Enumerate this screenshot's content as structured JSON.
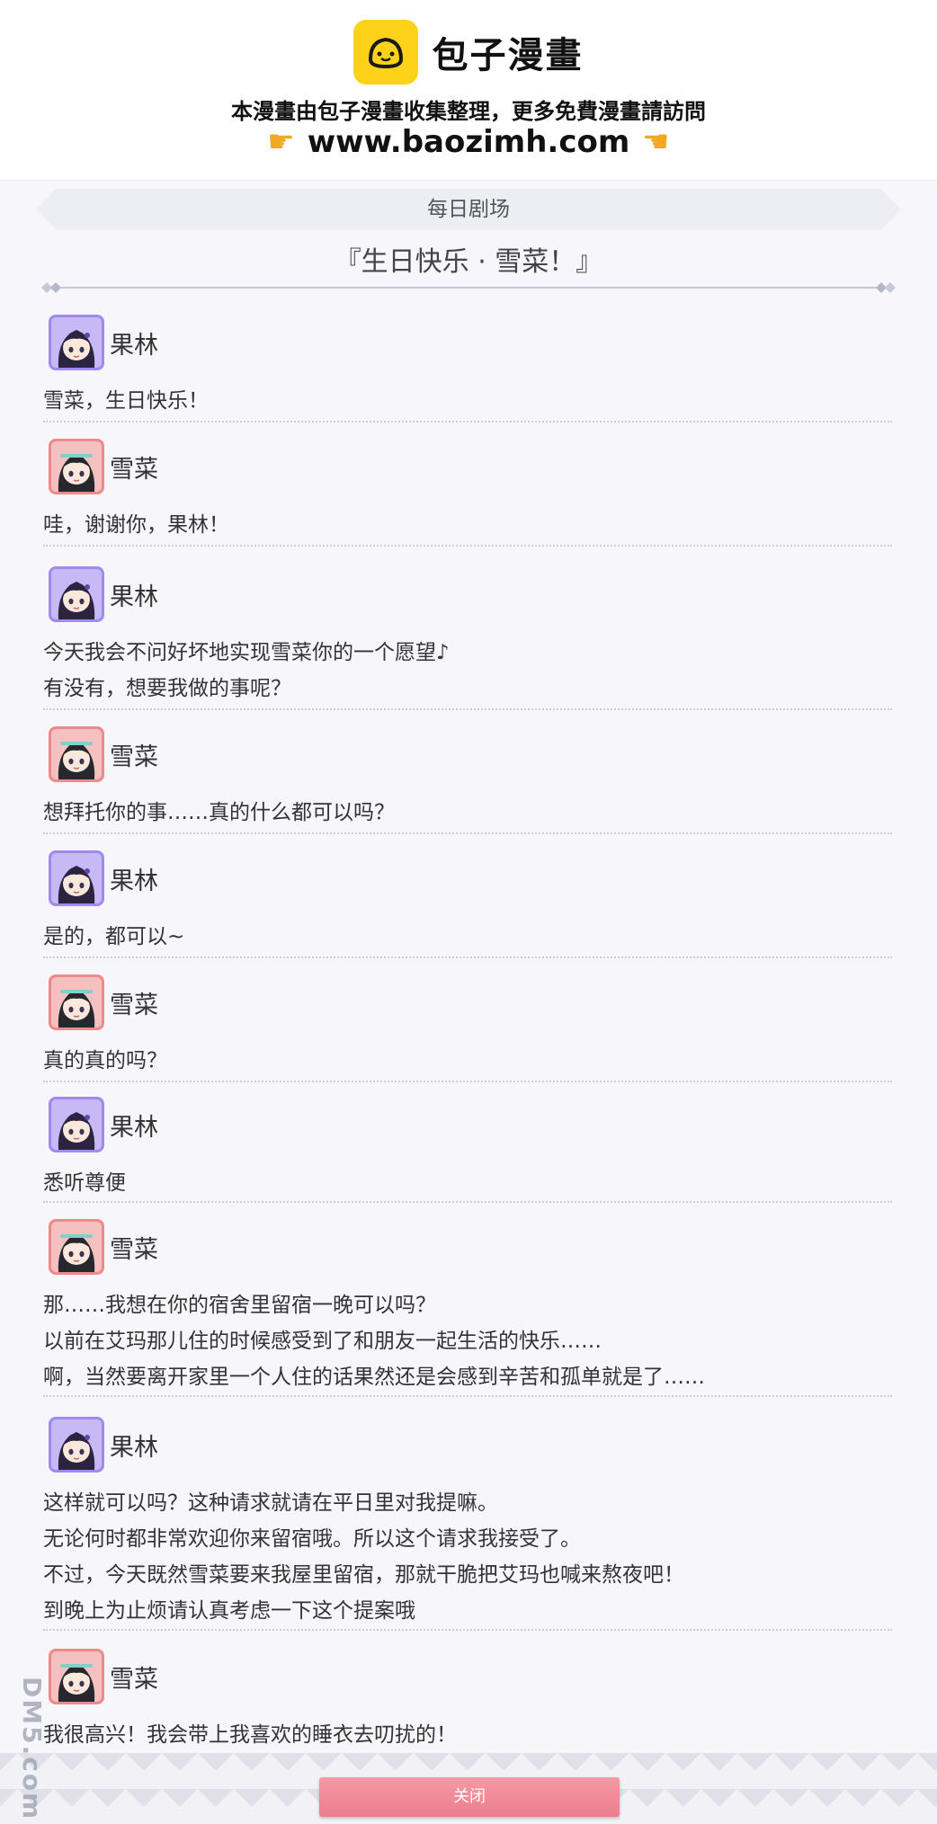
{
  "header": {
    "logo_name": "包子漫畫",
    "tagline": "本漫畫由包子漫畫收集整理，更多免費漫畫請訪問",
    "url": "www.baozimh.com",
    "pointer_icon": "pointing-hand-icon"
  },
  "section": {
    "label": "每日剧场",
    "story_title": "『生日快乐 · 雪菜！』"
  },
  "messages": [
    {
      "speaker": "果林",
      "avatar": "karin",
      "lines": [
        "雪菜，生日快乐！"
      ]
    },
    {
      "speaker": "雪菜",
      "avatar": "yukina",
      "lines": [
        "哇，谢谢你，果林！"
      ]
    },
    {
      "speaker": "果林",
      "avatar": "karin",
      "lines": [
        "今天我会不问好坏地实现雪菜你的一个愿望♪",
        "有没有，想要我做的事呢？"
      ]
    },
    {
      "speaker": "雪菜",
      "avatar": "yukina",
      "lines": [
        "想拜托你的事……真的什么都可以吗？"
      ]
    },
    {
      "speaker": "果林",
      "avatar": "karin",
      "lines": [
        "是的，都可以~"
      ]
    },
    {
      "speaker": "雪菜",
      "avatar": "yukina",
      "lines": [
        "真的真的吗？"
      ]
    },
    {
      "speaker": "果林",
      "avatar": "karin",
      "lines": [
        "悉听尊便"
      ]
    },
    {
      "speaker": "雪菜",
      "avatar": "yukina",
      "lines": [
        "那……我想在你的宿舍里留宿一晚可以吗？",
        "以前在艾玛那儿住的时候感受到了和朋友一起生活的快乐……",
        "啊，当然要离开家里一个人住的话果然还是会感到辛苦和孤单就是了……"
      ]
    },
    {
      "speaker": "果林",
      "avatar": "karin",
      "lines": [
        "这样就可以吗？这种请求就请在平日里对我提嘛。",
        "无论何时都非常欢迎你来留宿哦。所以这个请求我接受了。",
        "不过，今天既然雪菜要来我屋里留宿，那就干脆把艾玛也喊来熬夜吧！",
        "到晚上为止烦请认真考虑一下这个提案哦"
      ]
    },
    {
      "speaker": "雪菜",
      "avatar": "yukina",
      "lines": [
        "我很高兴！我会带上我喜欢的睡衣去叨扰的！"
      ]
    }
  ],
  "footer": {
    "close_label": "关闭",
    "watermark": "DM5.com"
  },
  "colors": {
    "close_button": "#ec7d8c",
    "karin_frame": "#7b62d8",
    "yukina_frame": "#e05454",
    "logo": "#ffd21a"
  }
}
